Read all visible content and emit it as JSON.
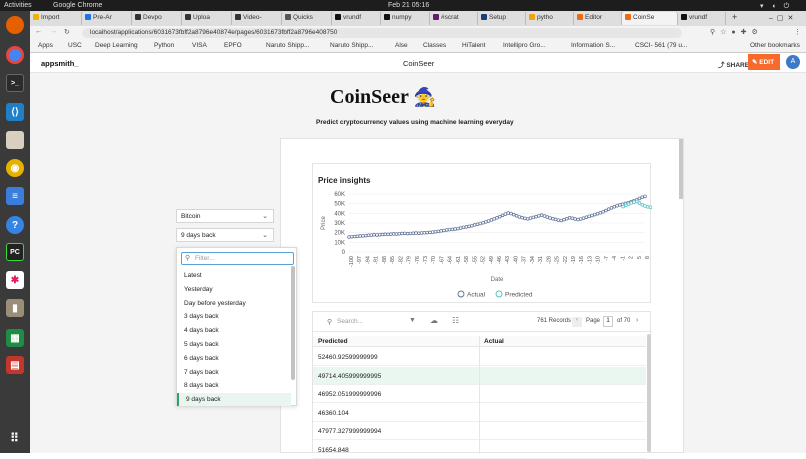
{
  "os": {
    "activities": "Activities",
    "app_name": "Google Chrome",
    "clock": "Feb 21  05:16"
  },
  "browser": {
    "tabs": [
      "Import",
      "Pre-Ar",
      "Devpo",
      "Uploa",
      "Video-",
      "Quicks",
      "vrundf",
      "numpy",
      "#scrat",
      "Setup",
      "pytho",
      "Editor",
      "CoinSe",
      "vrundf"
    ],
    "url": "localhost/applications/6031673fbff2a8796e40874e/pages/6031673fbff2a8796e408750",
    "bookmarks": [
      "Apps",
      "USC",
      "Deep Learning",
      "Python",
      "VISA",
      "EPFO",
      "Naruto Shipp...",
      "Naruto Shipp...",
      "Alse",
      "Classes",
      "HiTalent",
      "Intellipro Gro...",
      "Information S...",
      "CSCI- 561 (79 u..."
    ],
    "other_bookmarks": "Other bookmarks"
  },
  "app": {
    "logo": "appsmith_",
    "page_name": "CoinSeer",
    "share_label": "SHARE",
    "edit_label": "EDIT",
    "avatar_letter": "A"
  },
  "page": {
    "title": "CoinSeer",
    "title_emoji": "🧙",
    "subtitle": "Predict cryptocurrency values using machine learning everyday"
  },
  "selects": {
    "coin": "Bitcoin",
    "period": "9 days back"
  },
  "dropdown": {
    "filter_placeholder": "Filter...",
    "options": [
      "Latest",
      "Yesterday",
      "Day before yesterday",
      "3 days back",
      "4 days back",
      "5 days back",
      "6 days back",
      "7 days back",
      "8 days back",
      "9 days back"
    ],
    "selected_index": 9
  },
  "chart_data": {
    "type": "line",
    "title": "Price insights",
    "xlabel": "Date",
    "ylabel": "Price",
    "ylim": [
      0,
      60000
    ],
    "yticks": [
      "0",
      "10K",
      "20K",
      "30K",
      "40K",
      "50K",
      "60K"
    ],
    "xticks": [
      "-100",
      "-97",
      "-94",
      "-91",
      "-88",
      "-85",
      "-82",
      "-79",
      "-76",
      "-73",
      "-70",
      "-67",
      "-64",
      "-61",
      "-58",
      "-55",
      "-52",
      "-49",
      "-46",
      "-43",
      "-40",
      "-37",
      "-34",
      "-31",
      "-28",
      "-25",
      "-22",
      "-19",
      "-16",
      "-13",
      "-10",
      "-7",
      "-4",
      "-1",
      "2",
      "5",
      "8"
    ],
    "legend": "bottom",
    "series": [
      {
        "name": "Actual",
        "color": "#5b6f96",
        "x_start": -100,
        "x_step": 1,
        "values": [
          15500,
          15800,
          16000,
          16300,
          16500,
          16700,
          17000,
          17300,
          17500,
          17800,
          17600,
          17900,
          18100,
          18300,
          18200,
          18500,
          18700,
          18600,
          18900,
          19100,
          19300,
          19000,
          19200,
          19400,
          19600,
          19400,
          19700,
          19900,
          20100,
          20300,
          20600,
          21000,
          21400,
          21800,
          22300,
          22800,
          23200,
          23400,
          23800,
          24200,
          24800,
          25500,
          26000,
          26500,
          27200,
          28000,
          28700,
          29500,
          30300,
          31200,
          32100,
          33200,
          34300,
          35400,
          36600,
          37900,
          39200,
          40300,
          39800,
          38600,
          37500,
          36400,
          35500,
          34800,
          34300,
          35000,
          35800,
          36600,
          37400,
          38100,
          37200,
          36200,
          35200,
          34400,
          33700,
          33000,
          32600,
          33500,
          34400,
          35400,
          34900,
          34100,
          33600,
          34200,
          35100,
          36000,
          36900,
          37800,
          38700,
          39600,
          40600,
          41700,
          42900,
          44300,
          45600,
          46800,
          47900,
          48700,
          49400,
          50300,
          51000,
          51800,
          52900,
          54100,
          55400,
          56600,
          57600
        ]
      },
      {
        "name": "Predicted",
        "color": "#4ec2c2",
        "x_start": 0,
        "x_step": 1,
        "values": [
          47000,
          48200,
          49500,
          50800,
          51600,
          52300,
          50700,
          48900,
          47600,
          46800,
          46300,
          45900,
          45600
        ]
      }
    ]
  },
  "table": {
    "search_placeholder": "Search...",
    "records": "761 Records",
    "page_label": "Page",
    "page_current": "1",
    "page_total": "of 70",
    "columns": [
      "Predicted",
      "Actual"
    ],
    "rows": [
      {
        "predicted": "52460.92599999999",
        "actual": ""
      },
      {
        "predicted": "49714.405999999995",
        "actual": ""
      },
      {
        "predicted": "46952.051999999996",
        "actual": ""
      },
      {
        "predicted": "46360.104",
        "actual": ""
      },
      {
        "predicted": "47977.327999999994",
        "actual": ""
      },
      {
        "predicted": "51654.848",
        "actual": ""
      }
    ],
    "highlighted_row": 1
  }
}
